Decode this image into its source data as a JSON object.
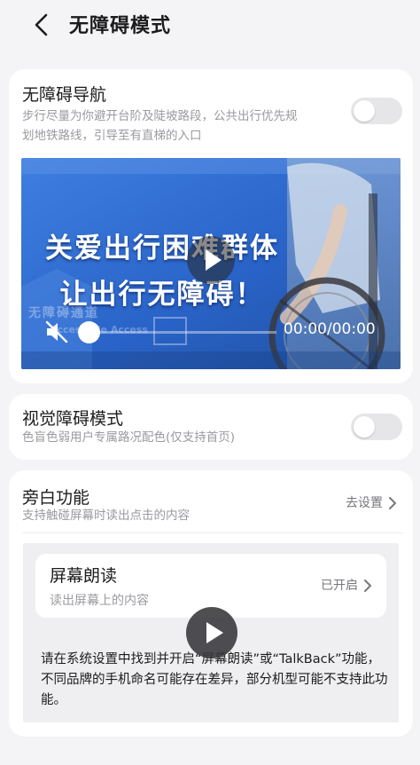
{
  "header": {
    "title": "无障碍模式",
    "back_icon": "chevron-left-icon"
  },
  "accessible_nav": {
    "title": "无障碍导航",
    "description_line1": "步行尽量为你避开台阶及陡坡路段，公共出行优先规",
    "description_line2": "划地铁路线，引导至有直梯的入口",
    "enabled": false
  },
  "video": {
    "headline_line1": "关爱出行困难群体",
    "headline_line2": "让出行无障碍！",
    "watermark": "无障碍通道",
    "watermark_en": "Accessible Access",
    "time": "00:00/00:00",
    "muted": true,
    "progress": 0
  },
  "visual_mode": {
    "title": "视觉障碍模式",
    "description": "色盲色弱用户专属路况配色(仅支持首页)",
    "enabled": false
  },
  "narration": {
    "title": "旁白功能",
    "description": "支持触碰屏幕时读出点击的内容",
    "link": "去设置",
    "screen_reader": {
      "title": "屏幕朗读",
      "description": "读出屏幕上的内容",
      "status": "已开启"
    },
    "info": "请在系统设置中找到并开启“屏幕朗读”或“TalkBack”功能，不同品牌的手机命名可能存在差异，部分机型可能不支持此功能。"
  },
  "colors": {
    "background": "#f4f4f6",
    "card": "#ffffff",
    "toggle_off": "#e6e6e9",
    "video_blue": "#2f6fd8"
  }
}
